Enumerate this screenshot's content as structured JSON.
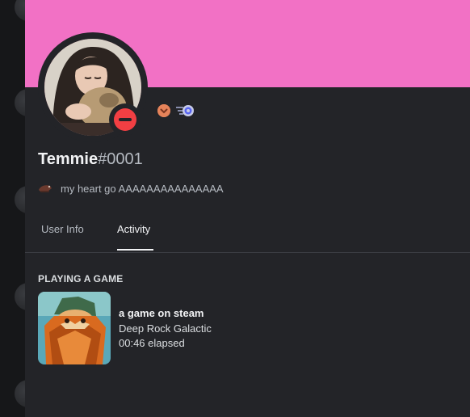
{
  "profile": {
    "banner_color": "#f271c5",
    "username": "Temmie",
    "discriminator": "#0001",
    "status": "do-not-disturb",
    "status_color": "#f23f43",
    "badges": [
      "chevron-down-icon",
      "nitro-icon"
    ],
    "custom_status": {
      "emoji": "sleigh-emoji",
      "text": "my heart go AAAAAAAAAAAAAAA"
    }
  },
  "tabs": [
    {
      "label": "User Info",
      "active": false
    },
    {
      "label": "Activity",
      "active": true
    }
  ],
  "activity": {
    "section_header": "PLAYING A GAME",
    "title": "a game on steam",
    "details": "Deep Rock Galactic",
    "elapsed": "00:46 elapsed"
  }
}
